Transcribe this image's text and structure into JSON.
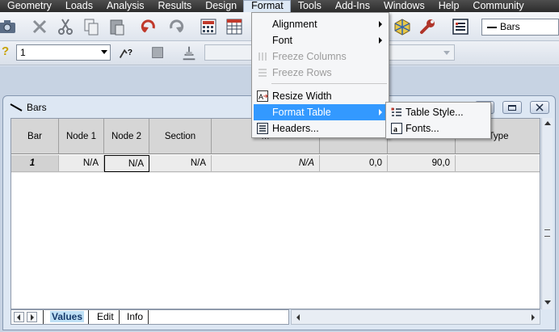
{
  "menubar": {
    "items": [
      "Geometry",
      "Loads",
      "Analysis",
      "Results",
      "Design",
      "Format",
      "Tools",
      "Add-Ins",
      "Windows",
      "Help",
      "Community"
    ]
  },
  "toolbar": {
    "selection_value": "1",
    "help_mark": "?",
    "bars_combo_value": "Bars"
  },
  "format_menu": {
    "items": [
      {
        "label": "Alignment",
        "submenu": true,
        "enabled": true
      },
      {
        "label": "Font",
        "submenu": true,
        "enabled": true
      },
      {
        "label": "Freeze Columns",
        "submenu": false,
        "enabled": false
      },
      {
        "label": "Freeze Rows",
        "submenu": false,
        "enabled": false
      },
      {
        "label": "Resize Width",
        "submenu": false,
        "enabled": true
      },
      {
        "label": "Format Table",
        "submenu": true,
        "enabled": true,
        "highlighted": true
      },
      {
        "label": "Headers...",
        "submenu": false,
        "enabled": true
      }
    ]
  },
  "format_table_submenu": {
    "items": [
      "Table Style...",
      "Fonts..."
    ]
  },
  "bars_window": {
    "title": "Bars",
    "columns": [
      "Bar",
      "Node 1",
      "Node 2",
      "Section",
      "M",
      "",
      "",
      "Type"
    ],
    "rows": [
      [
        "1",
        "N/A",
        "N/A",
        "N/A",
        "N/A",
        "0,0",
        "90,0",
        ""
      ]
    ],
    "tabs": [
      "Values",
      "Edit",
      "Info"
    ]
  }
}
